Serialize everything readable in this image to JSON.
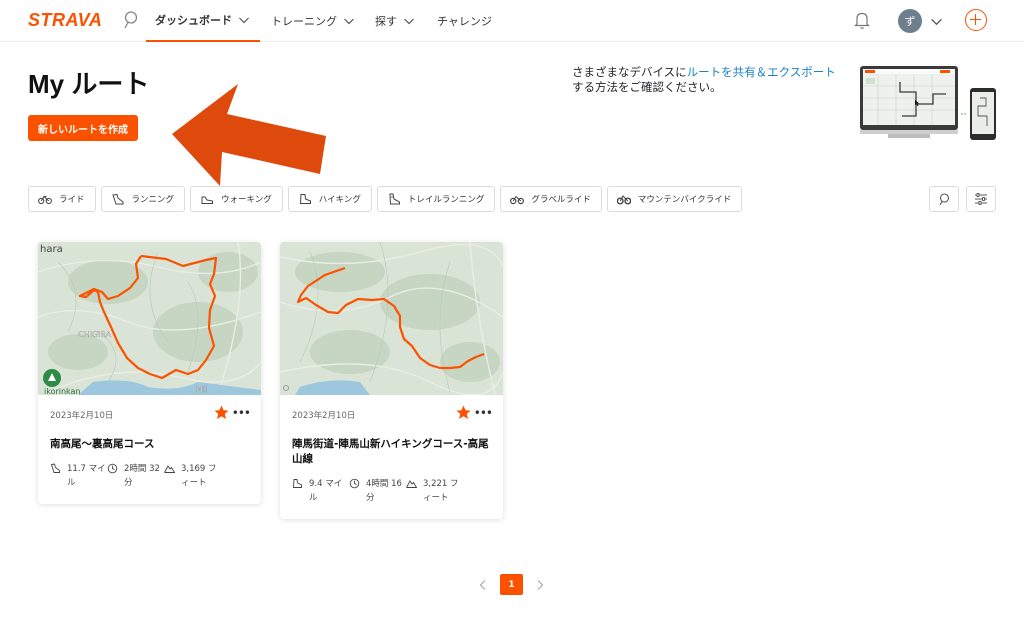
{
  "nav": {
    "logo": "STRAVA",
    "items": [
      {
        "label": "ダッシュボード",
        "has_chevron": true,
        "active": true
      },
      {
        "label": "トレーニング",
        "has_chevron": true,
        "active": false
      },
      {
        "label": "探す",
        "has_chevron": true,
        "active": false
      },
      {
        "label": "チャレンジ",
        "has_chevron": false,
        "active": false
      }
    ],
    "avatar_initial": "ず",
    "accent_color": "#fc5200"
  },
  "header": {
    "title": "My ルート",
    "new_route_button": "新しいルートを作成"
  },
  "promo": {
    "text_before": "さまざまなデバイスに",
    "link": "ルートを共有＆エクスポート",
    "text_after": "する方法をご確認ください。"
  },
  "filters": [
    {
      "label": "ライド",
      "icon": "bike-icon"
    },
    {
      "label": "ランニング",
      "icon": "shoe-icon"
    },
    {
      "label": "ウォーキング",
      "icon": "walking-shoe-icon"
    },
    {
      "label": "ハイキング",
      "icon": "hiking-boot-icon"
    },
    {
      "label": "トレイルランニング",
      "icon": "trail-shoe-icon"
    },
    {
      "label": "グラベルライド",
      "icon": "gravel-bike-icon"
    },
    {
      "label": "マウンテンバイクライド",
      "icon": "mountain-bike-icon"
    }
  ],
  "routes": [
    {
      "date": "2023年2月10日",
      "name": "南高尾〜裏高尾コース",
      "starred": true,
      "distance": "11.7 マイル",
      "time": "2時間 32 分",
      "elevation": "3,169 フィート",
      "map_labels": [
        "hara",
        "CHIGIRA",
        "ikorinkan",
        "MII"
      ]
    },
    {
      "date": "2023年2月10日",
      "name": "陣馬街道-陣馬山新ハイキングコース-高尾山線",
      "starred": true,
      "distance": "9.4 マイル",
      "time": "4時間 16 分",
      "elevation": "3,221 フィート",
      "map_labels": []
    }
  ],
  "pagination": {
    "current": "1"
  }
}
